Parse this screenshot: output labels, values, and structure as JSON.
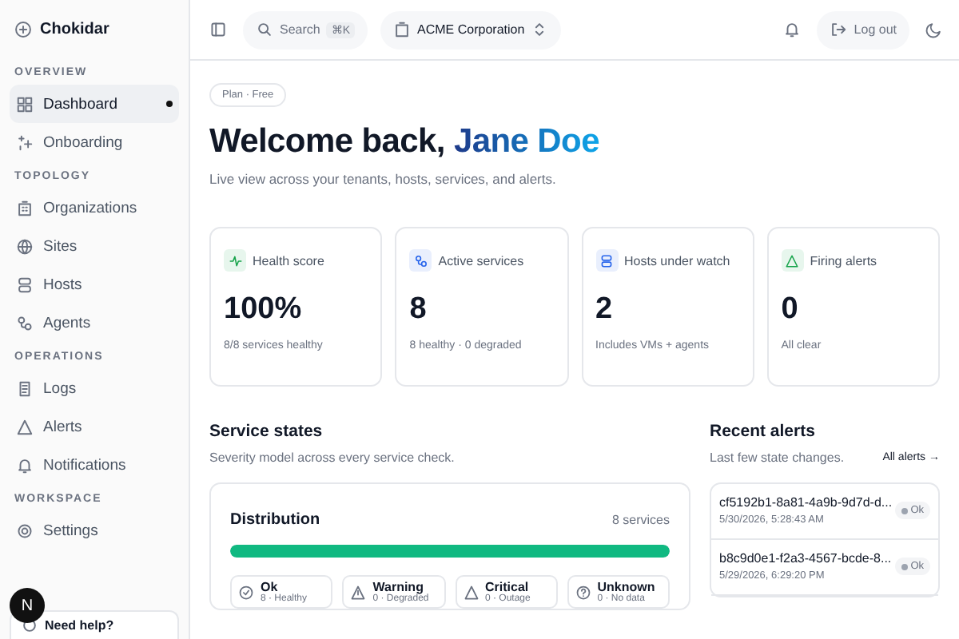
{
  "brand": {
    "name": "Chokidar"
  },
  "sidebar": {
    "sections": [
      {
        "title": "OVERVIEW",
        "items": [
          {
            "label": "Dashboard",
            "selected": true
          },
          {
            "label": "Onboarding",
            "selected": false
          }
        ]
      },
      {
        "title": "TOPOLOGY",
        "items": [
          {
            "label": "Organizations",
            "selected": false
          },
          {
            "label": "Sites",
            "selected": false
          },
          {
            "label": "Hosts",
            "selected": false
          },
          {
            "label": "Agents",
            "selected": false
          }
        ]
      },
      {
        "title": "OPERATIONS",
        "items": [
          {
            "label": "Logs",
            "selected": false
          },
          {
            "label": "Alerts",
            "selected": false
          },
          {
            "label": "Notifications",
            "selected": false
          }
        ]
      },
      {
        "title": "WORKSPACE",
        "items": [
          {
            "label": "Settings",
            "selected": false
          }
        ]
      }
    ],
    "help": {
      "title": "Need help?"
    },
    "avatar": {
      "letter": "N"
    }
  },
  "topbar": {
    "search": {
      "placeholder": "Search",
      "shortcut": "⌘K"
    },
    "org": "ACME Corporation",
    "logout": "Log out"
  },
  "plan": "Plan · Free",
  "greeting": {
    "prefix": "Welcome back, ",
    "name": "Jane Doe"
  },
  "subtitle": "Live view across your tenants, hosts, services, and alerts.",
  "cards": [
    {
      "label": "Health score",
      "value": "100%",
      "note": "8/8 services healthy",
      "color": "#16a34a"
    },
    {
      "label": "Active services",
      "value": "8",
      "note": "8 healthy · 0 degraded",
      "color": "#2563eb"
    },
    {
      "label": "Hosts under watch",
      "value": "2",
      "note": "Includes VMs + agents",
      "color": "#2563eb"
    },
    {
      "label": "Firing alerts",
      "value": "0",
      "note": "All clear",
      "color": "#16a34a"
    }
  ],
  "service_states": {
    "title": "Service states",
    "subtitle": "Severity model across every service check.",
    "distribution": {
      "title": "Distribution",
      "count": "8 services",
      "level": 1
    },
    "states": [
      {
        "kind": "ok",
        "label": "Ok",
        "note": "8 · Healthy"
      },
      {
        "kind": "warning",
        "label": "Warning",
        "note": "0 · Degraded"
      },
      {
        "kind": "critical",
        "label": "Critical",
        "note": "0 · Outage"
      },
      {
        "kind": "unknown",
        "label": "Unknown",
        "note": "0 · No data"
      }
    ]
  },
  "recent_alerts": {
    "title": "Recent alerts",
    "subtitle": "Last few state changes.",
    "link": "All alerts →",
    "items": [
      {
        "id": "cf5192b1-8a81-4a9b-9d7d-d...",
        "time": "5/30/2026, 5:28:43 AM",
        "status": "Ok"
      },
      {
        "id": "b8c9d0e1-f2a3-4567-bcde-8...",
        "time": "5/29/2026, 6:29:20 PM",
        "status": "Ok"
      }
    ]
  }
}
